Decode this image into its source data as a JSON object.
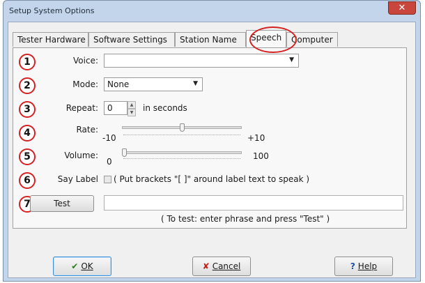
{
  "window": {
    "title": "Setup System Options",
    "close_glyph": "✕"
  },
  "tabs": [
    {
      "label": "Tester Hardware"
    },
    {
      "label": "Software Settings"
    },
    {
      "label": "Station Name"
    },
    {
      "label": "Speech"
    },
    {
      "label": "Computer"
    }
  ],
  "active_tab": "Speech",
  "speech": {
    "badges": [
      "1",
      "2",
      "3",
      "4",
      "5",
      "6",
      "7"
    ],
    "voice": {
      "label": "Voice:",
      "value": ""
    },
    "mode": {
      "label": "Mode:",
      "value": "None"
    },
    "repeat": {
      "label": "Repeat:",
      "value": "0",
      "unit": "in seconds"
    },
    "rate": {
      "label": "Rate:",
      "min": "-10",
      "max": "+10",
      "level": 0.5
    },
    "volume": {
      "label": "Volume:",
      "min": "0",
      "max": "100",
      "level": 0.0
    },
    "say_label": {
      "label": "Say Label",
      "hint": "( Put brackets \"[ ]\" around label text to speak )",
      "checked": false
    },
    "test": {
      "button": "Test",
      "phrase": "",
      "hint": "( To test:  enter phrase and press \"Test\" )"
    }
  },
  "footer": {
    "ok": {
      "icon": "✔",
      "label": "OK"
    },
    "cancel": {
      "icon": "✘",
      "label": "Cancel"
    },
    "help": {
      "icon": "?",
      "label": "Help"
    }
  },
  "colors": {
    "accent_red": "#d42020",
    "ok_check": "#2c7a1e",
    "cancel_x": "#c0201a",
    "help_q": "#1f4ea8"
  }
}
